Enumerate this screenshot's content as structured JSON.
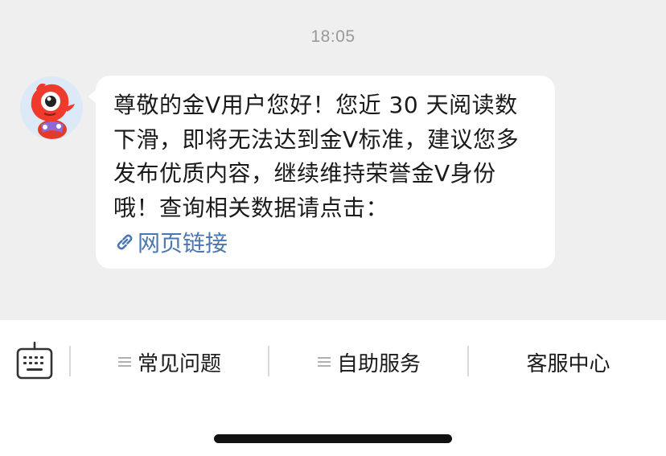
{
  "chat": {
    "time": "18:05",
    "message": {
      "text": "尊敬的金V用户您好！您近 30 天阅读数下滑，即将无法达到金V标准，建议您多发布优质内容，继续维持荣誉金V身份哦！查询相关数据请点击：",
      "link_label": "网页链接",
      "link_icon": "link-icon"
    },
    "avatar_icon": "red-mascot-avatar"
  },
  "menu": {
    "keyboard_icon": "keyboard-icon",
    "items": [
      {
        "label": "常见问题",
        "icon": "menu-lines-icon"
      },
      {
        "label": "自助服务",
        "icon": "menu-lines-icon"
      },
      {
        "label": "客服中心"
      }
    ]
  },
  "colors": {
    "chat_bg": "#efefef",
    "bubble_bg": "#ffffff",
    "link": "#4a77b0",
    "time": "#999999"
  }
}
